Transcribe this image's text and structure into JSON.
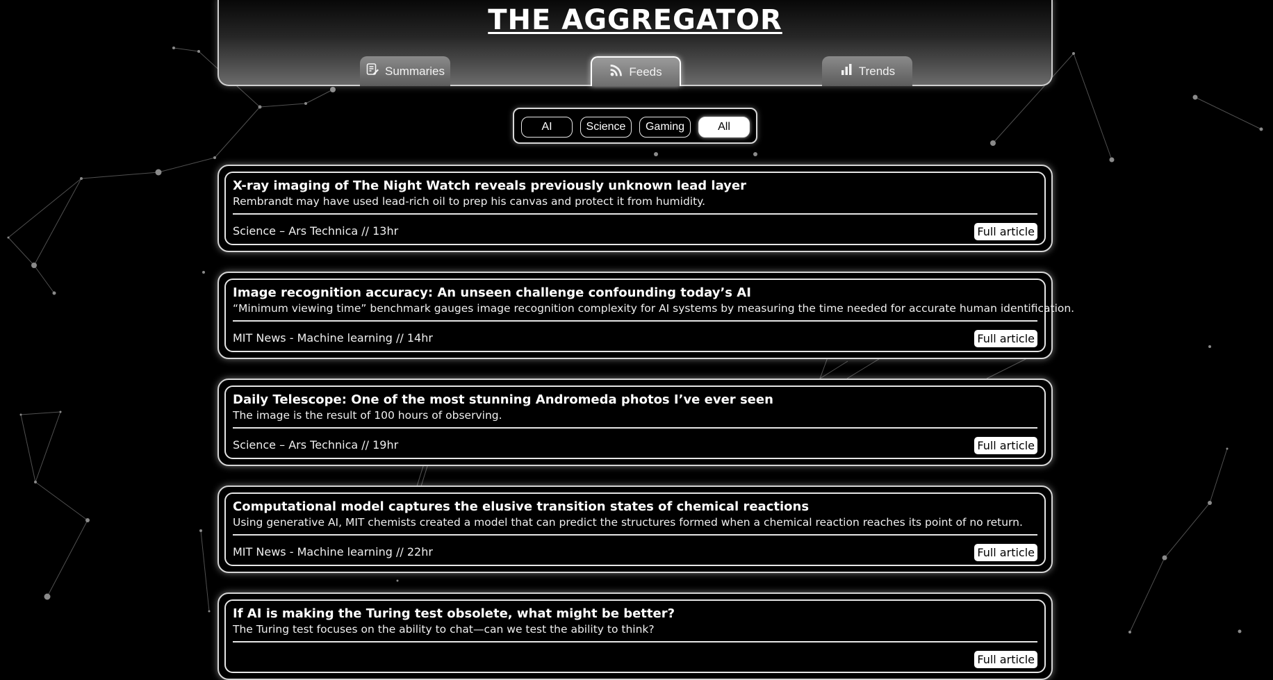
{
  "header": {
    "title": "THE AGGREGATOR",
    "tabs": [
      {
        "label": "Summaries",
        "icon": "summary-icon",
        "active": false
      },
      {
        "label": "Feeds",
        "icon": "rss-icon",
        "active": true
      },
      {
        "label": "Trends",
        "icon": "bar-chart-icon",
        "active": false
      }
    ]
  },
  "filters": {
    "options": [
      "AI",
      "Science",
      "Gaming",
      "All"
    ],
    "selected": "All"
  },
  "articles": [
    {
      "title": "X-ray imaging of The Night Watch reveals previously unknown lead layer",
      "summary": "Rembrandt may have used lead-rich oil to prep his canvas and protect it from humidity.",
      "meta": "Science – Ars Technica // 13hr",
      "link_label": "Full article"
    },
    {
      "title": "Image recognition accuracy: An unseen challenge confounding today’s AI",
      "summary": "“Minimum viewing time” benchmark gauges image recognition complexity for AI systems by measuring the time needed for accurate human identification.",
      "meta": "MIT News - Machine learning // 14hr",
      "link_label": "Full article"
    },
    {
      "title": "Daily Telescope: One of the most stunning Andromeda photos I’ve ever seen",
      "summary": "The image is the result of 100 hours of observing.",
      "meta": "Science – Ars Technica // 19hr",
      "link_label": "Full article"
    },
    {
      "title": "Computational model captures the elusive transition states of chemical reactions",
      "summary": "Using generative AI, MIT chemists created a model that can predict the structures formed when a chemical reaction reaches its point of no return.",
      "meta": "MIT News - Machine learning // 22hr",
      "link_label": "Full article"
    },
    {
      "title": "If AI is making the Turing test obsolete, what might be better?",
      "summary": "The Turing test focuses on the ability to chat—can we test the ability to think?",
      "meta": "",
      "link_label": "Full article"
    }
  ],
  "colors": {
    "background": "#000000",
    "panel_border": "#d6d6d6",
    "accent": "#ffffff",
    "tab_fill": "#7a7a7a"
  }
}
